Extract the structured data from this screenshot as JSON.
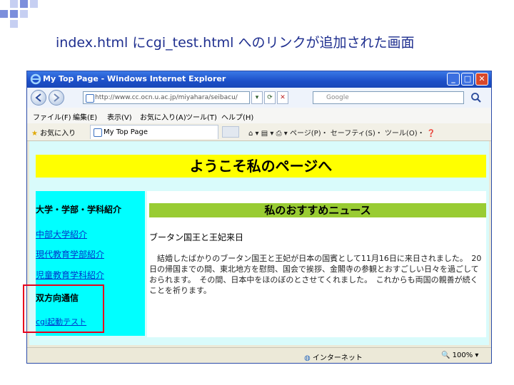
{
  "slide": {
    "title": "index.html にcgi_test.html へのリンクが追加された画面",
    "accent_colors": [
      "#b8c4ee",
      "#7c8fdc"
    ]
  },
  "browser": {
    "window_title": "My Top Page - Windows Internet Explorer",
    "address_url": "http://www.cc.ocn.u.ac.jp/miyahara/seibacu/",
    "search_placeholder": "Google",
    "menu": [
      "ファイル(F)",
      "編集(E)",
      "表示(V)",
      "お気に入り(A)",
      "ツール(T)",
      "ヘルプ(H)"
    ],
    "favorites_label": "お気に入り",
    "tab_label": "My Top Page",
    "tools_text": "ページ(P)・ セーフティ(S)・ ツール(O)・",
    "status_zone": "インターネット",
    "zoom": "100%",
    "icons": [
      "ie-logo-icon",
      "back-arrow-icon",
      "forward-arrow-icon",
      "refresh-icon",
      "stop-icon",
      "search-icon",
      "star-icon",
      "home-icon",
      "print-icon",
      "help-icon"
    ]
  },
  "page": {
    "banner": "ようこそ私のページへ",
    "sidebar_heading": "大学・学部・学科紹介",
    "sidebar_links": [
      "中部大学紹介",
      "現代教育学部紹介",
      "児童教育学科紹介"
    ],
    "sidebar_section": "双方向通信",
    "sidebar_cgi_link": "cgi起動テスト",
    "news_heading": "私のおすすめニュース",
    "news_title": "ブータン国王と王妃来日",
    "news_body": "　結婚したばかりのブータン国王と王妃が日本の国賓として11月16日に来日されました。　20日の帰国までの間、東北地方を慰問、国会で挨拶、金閣寺の参観とおすごしい日々を過ごしておられます。　その間、日本中をほのぼのとさせてくれました。　これからも両国の親善が続くことを祈ります。"
  },
  "colors": {
    "banner": "#ffff00",
    "sidebar": "#00ffff",
    "news_heading": "#99cc33",
    "page_bg": "#d9fbfb",
    "highlight": "#e8001c"
  }
}
